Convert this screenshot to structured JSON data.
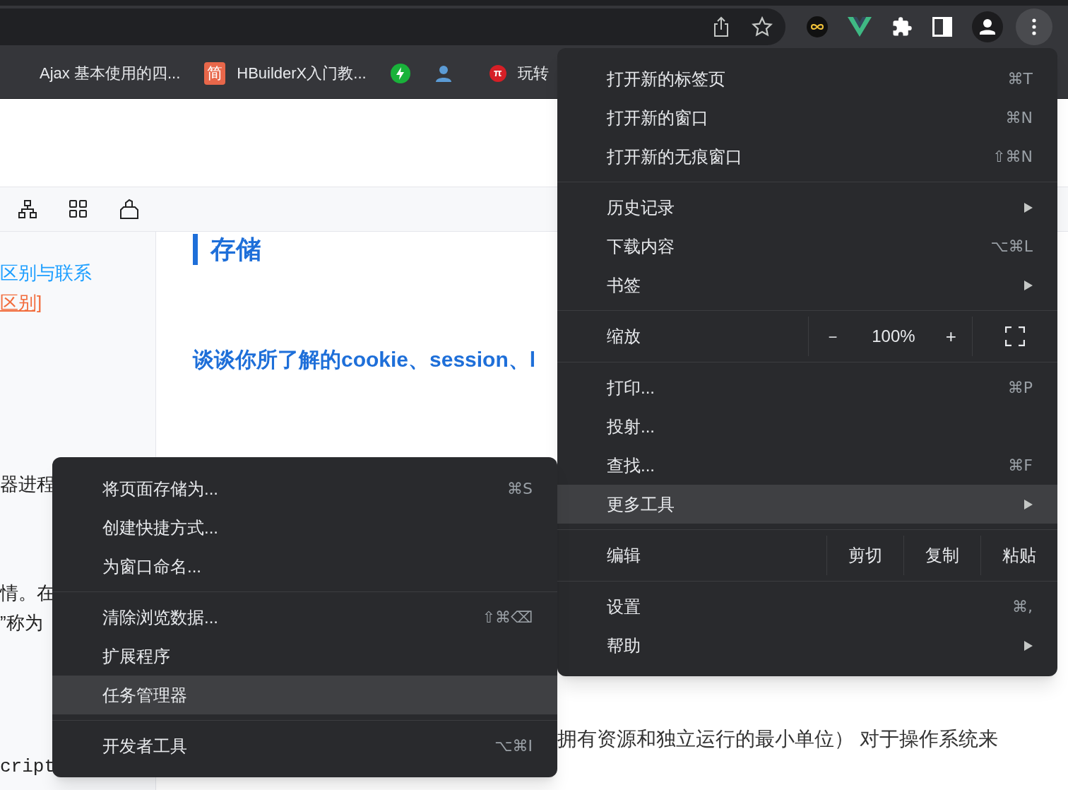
{
  "bookmarks": [
    {
      "kind": "text",
      "label": "Ajax 基本使用的四..."
    },
    {
      "kind": "badge",
      "badge": "简",
      "label": "HBuilderX入门教..."
    },
    {
      "kind": "bolt"
    },
    {
      "kind": "person"
    },
    {
      "kind": "pi",
      "badge": "π",
      "label": "玩转"
    }
  ],
  "sidebar_links": [
    {
      "text": "区别与联系",
      "color": "#1e9fff"
    },
    {
      "text": "区别]",
      "color": "#f26d3d"
    }
  ],
  "left_fragments": [
    "器进程",
    "情。在",
    "”称为",
    "cript"
  ],
  "article": {
    "heading": "存储",
    "question": "谈谈你所了解的cookie、session、l",
    "paragraph_1": "拥有资源和独立运行的最小单位） 对于操作系统来"
  },
  "main_menu": [
    {
      "kind": "item",
      "label": "打开新的标签页",
      "shortcut": "⌘T",
      "selected": false
    },
    {
      "kind": "item",
      "label": "打开新的窗口",
      "shortcut": "⌘N",
      "selected": false
    },
    {
      "kind": "item",
      "label": "打开新的无痕窗口",
      "shortcut": "⇧⌘N",
      "selected": false
    },
    {
      "kind": "separator"
    },
    {
      "kind": "item",
      "label": "历史记录",
      "submenu": true,
      "selected": false
    },
    {
      "kind": "item",
      "label": "下载内容",
      "shortcut": "⌥⌘L",
      "selected": false
    },
    {
      "kind": "item",
      "label": "书签",
      "submenu": true,
      "selected": false
    },
    {
      "kind": "separator"
    },
    {
      "kind": "zoom",
      "label": "缩放",
      "minus": "－",
      "value": "100%",
      "plus": "+"
    },
    {
      "kind": "separator"
    },
    {
      "kind": "item",
      "label": "打印...",
      "shortcut": "⌘P",
      "selected": false
    },
    {
      "kind": "item",
      "label": "投射...",
      "selected": false
    },
    {
      "kind": "item",
      "label": "查找...",
      "shortcut": "⌘F",
      "selected": false
    },
    {
      "kind": "item",
      "label": "更多工具",
      "submenu": true,
      "selected": true
    },
    {
      "kind": "separator"
    },
    {
      "kind": "edit",
      "label": "编辑",
      "actions": [
        "剪切",
        "复制",
        "粘贴"
      ]
    },
    {
      "kind": "separator"
    },
    {
      "kind": "item",
      "label": "设置",
      "shortcut": "⌘,",
      "selected": false
    },
    {
      "kind": "item",
      "label": "帮助",
      "submenu": true,
      "selected": false
    }
  ],
  "more_tools_menu": [
    {
      "kind": "item",
      "label": "将页面存储为...",
      "shortcut": "⌘S",
      "selected": false
    },
    {
      "kind": "item",
      "label": "创建快捷方式...",
      "selected": false
    },
    {
      "kind": "item",
      "label": "为窗口命名...",
      "selected": false
    },
    {
      "kind": "separator"
    },
    {
      "kind": "item",
      "label": "清除浏览数据...",
      "shortcut": "⇧⌘⌫",
      "selected": false
    },
    {
      "kind": "item",
      "label": "扩展程序",
      "selected": false
    },
    {
      "kind": "item",
      "label": "任务管理器",
      "selected": true
    },
    {
      "kind": "separator"
    },
    {
      "kind": "item",
      "label": "开发者工具",
      "shortcut": "⌥⌘I",
      "selected": false
    }
  ]
}
